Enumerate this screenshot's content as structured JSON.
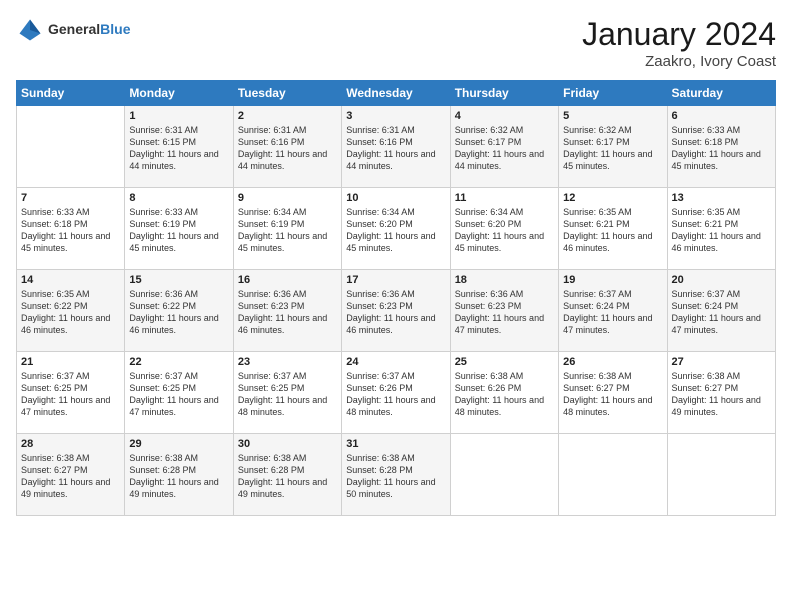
{
  "header": {
    "logo_general": "General",
    "logo_blue": "Blue",
    "month_title": "January 2024",
    "location": "Zaakro, Ivory Coast"
  },
  "weekdays": [
    "Sunday",
    "Monday",
    "Tuesday",
    "Wednesday",
    "Thursday",
    "Friday",
    "Saturday"
  ],
  "weeks": [
    [
      {
        "day": "",
        "sunrise": "",
        "sunset": "",
        "daylight": ""
      },
      {
        "day": "1",
        "sunrise": "Sunrise: 6:31 AM",
        "sunset": "Sunset: 6:15 PM",
        "daylight": "Daylight: 11 hours and 44 minutes."
      },
      {
        "day": "2",
        "sunrise": "Sunrise: 6:31 AM",
        "sunset": "Sunset: 6:16 PM",
        "daylight": "Daylight: 11 hours and 44 minutes."
      },
      {
        "day": "3",
        "sunrise": "Sunrise: 6:31 AM",
        "sunset": "Sunset: 6:16 PM",
        "daylight": "Daylight: 11 hours and 44 minutes."
      },
      {
        "day": "4",
        "sunrise": "Sunrise: 6:32 AM",
        "sunset": "Sunset: 6:17 PM",
        "daylight": "Daylight: 11 hours and 44 minutes."
      },
      {
        "day": "5",
        "sunrise": "Sunrise: 6:32 AM",
        "sunset": "Sunset: 6:17 PM",
        "daylight": "Daylight: 11 hours and 45 minutes."
      },
      {
        "day": "6",
        "sunrise": "Sunrise: 6:33 AM",
        "sunset": "Sunset: 6:18 PM",
        "daylight": "Daylight: 11 hours and 45 minutes."
      }
    ],
    [
      {
        "day": "7",
        "sunrise": "Sunrise: 6:33 AM",
        "sunset": "Sunset: 6:18 PM",
        "daylight": "Daylight: 11 hours and 45 minutes."
      },
      {
        "day": "8",
        "sunrise": "Sunrise: 6:33 AM",
        "sunset": "Sunset: 6:19 PM",
        "daylight": "Daylight: 11 hours and 45 minutes."
      },
      {
        "day": "9",
        "sunrise": "Sunrise: 6:34 AM",
        "sunset": "Sunset: 6:19 PM",
        "daylight": "Daylight: 11 hours and 45 minutes."
      },
      {
        "day": "10",
        "sunrise": "Sunrise: 6:34 AM",
        "sunset": "Sunset: 6:20 PM",
        "daylight": "Daylight: 11 hours and 45 minutes."
      },
      {
        "day": "11",
        "sunrise": "Sunrise: 6:34 AM",
        "sunset": "Sunset: 6:20 PM",
        "daylight": "Daylight: 11 hours and 45 minutes."
      },
      {
        "day": "12",
        "sunrise": "Sunrise: 6:35 AM",
        "sunset": "Sunset: 6:21 PM",
        "daylight": "Daylight: 11 hours and 46 minutes."
      },
      {
        "day": "13",
        "sunrise": "Sunrise: 6:35 AM",
        "sunset": "Sunset: 6:21 PM",
        "daylight": "Daylight: 11 hours and 46 minutes."
      }
    ],
    [
      {
        "day": "14",
        "sunrise": "Sunrise: 6:35 AM",
        "sunset": "Sunset: 6:22 PM",
        "daylight": "Daylight: 11 hours and 46 minutes."
      },
      {
        "day": "15",
        "sunrise": "Sunrise: 6:36 AM",
        "sunset": "Sunset: 6:22 PM",
        "daylight": "Daylight: 11 hours and 46 minutes."
      },
      {
        "day": "16",
        "sunrise": "Sunrise: 6:36 AM",
        "sunset": "Sunset: 6:23 PM",
        "daylight": "Daylight: 11 hours and 46 minutes."
      },
      {
        "day": "17",
        "sunrise": "Sunrise: 6:36 AM",
        "sunset": "Sunset: 6:23 PM",
        "daylight": "Daylight: 11 hours and 46 minutes."
      },
      {
        "day": "18",
        "sunrise": "Sunrise: 6:36 AM",
        "sunset": "Sunset: 6:23 PM",
        "daylight": "Daylight: 11 hours and 47 minutes."
      },
      {
        "day": "19",
        "sunrise": "Sunrise: 6:37 AM",
        "sunset": "Sunset: 6:24 PM",
        "daylight": "Daylight: 11 hours and 47 minutes."
      },
      {
        "day": "20",
        "sunrise": "Sunrise: 6:37 AM",
        "sunset": "Sunset: 6:24 PM",
        "daylight": "Daylight: 11 hours and 47 minutes."
      }
    ],
    [
      {
        "day": "21",
        "sunrise": "Sunrise: 6:37 AM",
        "sunset": "Sunset: 6:25 PM",
        "daylight": "Daylight: 11 hours and 47 minutes."
      },
      {
        "day": "22",
        "sunrise": "Sunrise: 6:37 AM",
        "sunset": "Sunset: 6:25 PM",
        "daylight": "Daylight: 11 hours and 47 minutes."
      },
      {
        "day": "23",
        "sunrise": "Sunrise: 6:37 AM",
        "sunset": "Sunset: 6:25 PM",
        "daylight": "Daylight: 11 hours and 48 minutes."
      },
      {
        "day": "24",
        "sunrise": "Sunrise: 6:37 AM",
        "sunset": "Sunset: 6:26 PM",
        "daylight": "Daylight: 11 hours and 48 minutes."
      },
      {
        "day": "25",
        "sunrise": "Sunrise: 6:38 AM",
        "sunset": "Sunset: 6:26 PM",
        "daylight": "Daylight: 11 hours and 48 minutes."
      },
      {
        "day": "26",
        "sunrise": "Sunrise: 6:38 AM",
        "sunset": "Sunset: 6:27 PM",
        "daylight": "Daylight: 11 hours and 48 minutes."
      },
      {
        "day": "27",
        "sunrise": "Sunrise: 6:38 AM",
        "sunset": "Sunset: 6:27 PM",
        "daylight": "Daylight: 11 hours and 49 minutes."
      }
    ],
    [
      {
        "day": "28",
        "sunrise": "Sunrise: 6:38 AM",
        "sunset": "Sunset: 6:27 PM",
        "daylight": "Daylight: 11 hours and 49 minutes."
      },
      {
        "day": "29",
        "sunrise": "Sunrise: 6:38 AM",
        "sunset": "Sunset: 6:28 PM",
        "daylight": "Daylight: 11 hours and 49 minutes."
      },
      {
        "day": "30",
        "sunrise": "Sunrise: 6:38 AM",
        "sunset": "Sunset: 6:28 PM",
        "daylight": "Daylight: 11 hours and 49 minutes."
      },
      {
        "day": "31",
        "sunrise": "Sunrise: 6:38 AM",
        "sunset": "Sunset: 6:28 PM",
        "daylight": "Daylight: 11 hours and 50 minutes."
      },
      {
        "day": "",
        "sunrise": "",
        "sunset": "",
        "daylight": ""
      },
      {
        "day": "",
        "sunrise": "",
        "sunset": "",
        "daylight": ""
      },
      {
        "day": "",
        "sunrise": "",
        "sunset": "",
        "daylight": ""
      }
    ]
  ]
}
